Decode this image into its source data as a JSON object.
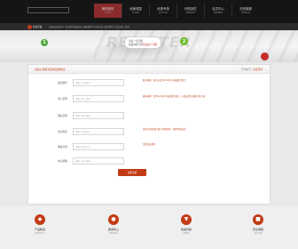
{
  "nav": {
    "items": [
      {
        "cn": "网站首页",
        "en": "HOME"
      },
      {
        "cn": "经营范围",
        "en": "SCOPE"
      },
      {
        "cn": "优惠专场",
        "en": "ACTIVITY"
      },
      {
        "cn": "你的回忆",
        "en": "MEMORY"
      },
      {
        "cn": "会员中心",
        "en": "MEMBER"
      },
      {
        "cn": "在线客服",
        "en": "SERVICE"
      }
    ],
    "active_index": 0
  },
  "infobar": {
    "logo_text": "欢迎光临",
    "text": "欢迎您来到本站！本站提供优质服务 | 客服热线 24小时在线 | 诚信经营 | 会员注册 | 登录"
  },
  "banner": {
    "word": "REGISTER",
    "bubble_line1": "这是一段问题",
    "bubble_line2_prefix": "看看你能不能",
    "bubble_line2_highlight": "答出这个问题",
    "badge_left": "1",
    "badge_mid": "2",
    "badge_right": ""
  },
  "panel": {
    "title": "请您认真填写您的注册信息",
    "subtitle_prefix": "已有帐号？",
    "subtitle_link": "直接登录"
  },
  "form": {
    "rows": [
      {
        "label": "会员帐号",
        "placeholder": "请输入会员帐号",
        "note": "账号规则：账号长度为6-12位字母和数字组合"
      },
      {
        "label": "登入密码",
        "placeholder": "请输入登入密码",
        "note": "密码规则：须为6-16位字母和数字组合，以及必须包含数字和字母"
      },
      {
        "label": "确认密码",
        "placeholder": "请输入确认密码",
        "note": ""
      },
      {
        "label": "真实姓名",
        "placeholder": "请输入真实姓名",
        "note": "必须与您的银行账户名称相同，否则不能出款！"
      },
      {
        "label": "联系方式",
        "placeholder": "请输入联系方式",
        "note": "请您如实填写"
      },
      {
        "label": "电子邮箱",
        "placeholder": "请输入电子邮箱",
        "note": ""
      }
    ],
    "submit_label": "立即注册"
  },
  "footer": {
    "features": [
      {
        "icon": "diamond-icon",
        "label": "产品精选",
        "sub": "PRODUCT"
      },
      {
        "icon": "user-icon",
        "label": "需求我上",
        "sub": "DEMAND"
      },
      {
        "icon": "shield-icon",
        "label": "极速到账",
        "sub": "SPEED"
      },
      {
        "icon": "lock-icon",
        "label": "安全保障",
        "sub": "SECURE"
      }
    ]
  },
  "colors": {
    "accent": "#c23b16",
    "nav_bg": "#151515",
    "nav_active": "#8b2b2b"
  }
}
